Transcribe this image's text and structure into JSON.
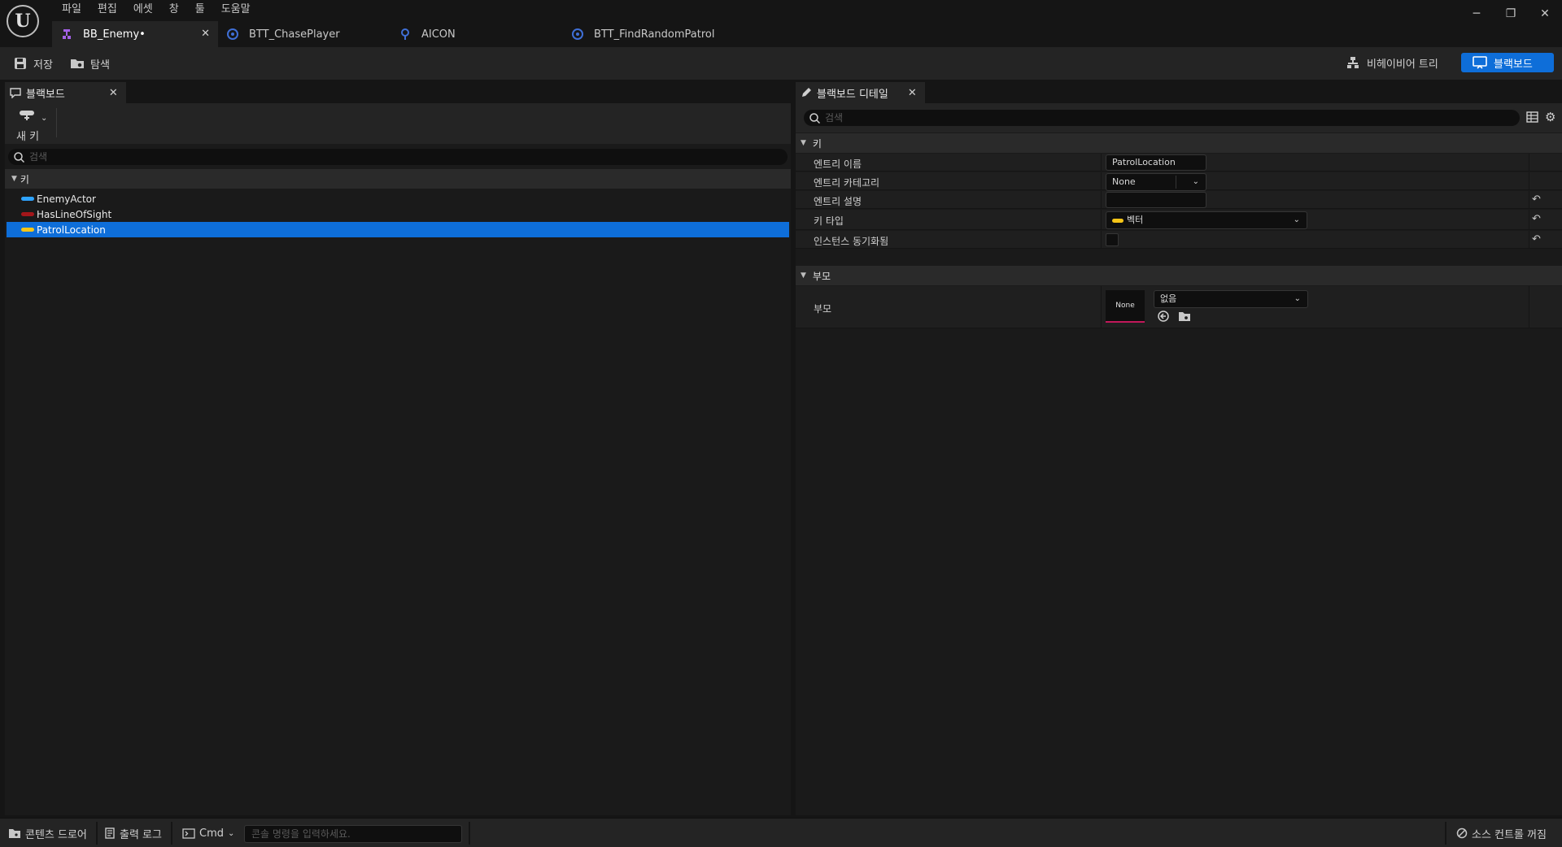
{
  "app": {
    "logo_letter": "U",
    "menu": [
      "파일",
      "편집",
      "에셋",
      "창",
      "툴",
      "도움말"
    ],
    "window_controls": [
      "─",
      "❐",
      "✕"
    ]
  },
  "tabs": [
    {
      "label": "BB_Enemy•",
      "icon": "blackboard-icon",
      "active": true
    },
    {
      "label": "BTT_ChasePlayer",
      "icon": "blueprint-icon",
      "active": false
    },
    {
      "label": "AICON",
      "icon": "ai-controller-icon",
      "active": false
    },
    {
      "label": "BTT_FindRandomPatrol",
      "icon": "blueprint-icon",
      "active": false
    }
  ],
  "toolbar": {
    "save_label": "저장",
    "browse_label": "탐색",
    "behavior_tree_label": "비헤이비어 트리",
    "blackboard_label": "블랙보드"
  },
  "blackboard_panel": {
    "tab_label": "블랙보드",
    "new_key_label": "새 키",
    "search_placeholder": "검색",
    "keys_header": "키",
    "keys": [
      {
        "name": "EnemyActor",
        "color": "#2ea3ff"
      },
      {
        "name": "HasLineOfSight",
        "color": "#a3161a"
      },
      {
        "name": "PatrolLocation",
        "color": "#f5c518"
      }
    ],
    "selected_key": "PatrolLocation"
  },
  "details_panel": {
    "tab_label": "블랙보드 디테일",
    "search_placeholder": "검색",
    "key_section": "키",
    "entry_name_label": "엔트리 이름",
    "entry_name_value": "PatrolLocation",
    "entry_category_label": "엔트리 카테고리",
    "entry_category_value": "None",
    "entry_description_label": "엔트리 설명",
    "entry_description_value": "",
    "key_type_label": "키 타입",
    "key_type_value": "벡터",
    "key_type_color": "#f5c518",
    "instance_synced_label": "인스턴스 동기화됨",
    "instance_synced": false,
    "parent_section": "부모",
    "parent_label": "부모",
    "parent_thumb": "None",
    "parent_value": "없음"
  },
  "statusbar": {
    "content_drawer": "콘텐츠 드로어",
    "output_log": "출력 로그",
    "cmd_label": "Cmd",
    "cmd_placeholder": "콘솔 명령을 입력하세요.",
    "source_control": "소스 컨트롤 꺼짐"
  },
  "colors": {
    "accent": "#0e6ed9",
    "background": "#151515",
    "panel": "#242424"
  }
}
